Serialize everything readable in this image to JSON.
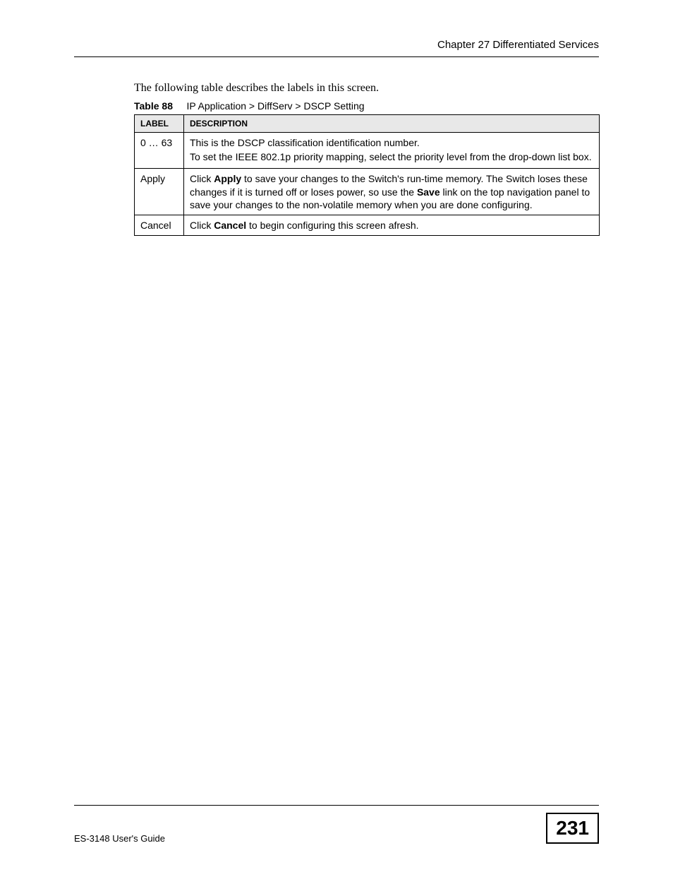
{
  "header": {
    "chapter": "Chapter 27 Differentiated Services"
  },
  "intro": "The following table describes the labels in this screen.",
  "table_caption": {
    "num": "Table 88",
    "title": "IP Application > DiffServ > DSCP Setting"
  },
  "table": {
    "headers": {
      "label": "LABEL",
      "description": "DESCRIPTION"
    },
    "rows": [
      {
        "label": "0 … 63",
        "desc_p1": "This is the DSCP classification identification number.",
        "desc_p2": "To set the IEEE 802.1p priority mapping, select the priority level from the drop-down list box."
      },
      {
        "label": "Apply",
        "desc_pre": "Click ",
        "desc_bold1": "Apply",
        "desc_mid1": " to save your changes to the Switch's run-time memory. The Switch loses these changes if it is turned off or loses power, so use the ",
        "desc_bold2": "Save",
        "desc_mid2": " link on the top navigation panel to save your changes to the non-volatile memory when you are done configuring."
      },
      {
        "label": "Cancel",
        "desc_pre": "Click ",
        "desc_bold1": "Cancel",
        "desc_post": " to begin configuring this screen afresh."
      }
    ]
  },
  "footer": {
    "guide": "ES-3148 User's Guide",
    "page": "231"
  }
}
